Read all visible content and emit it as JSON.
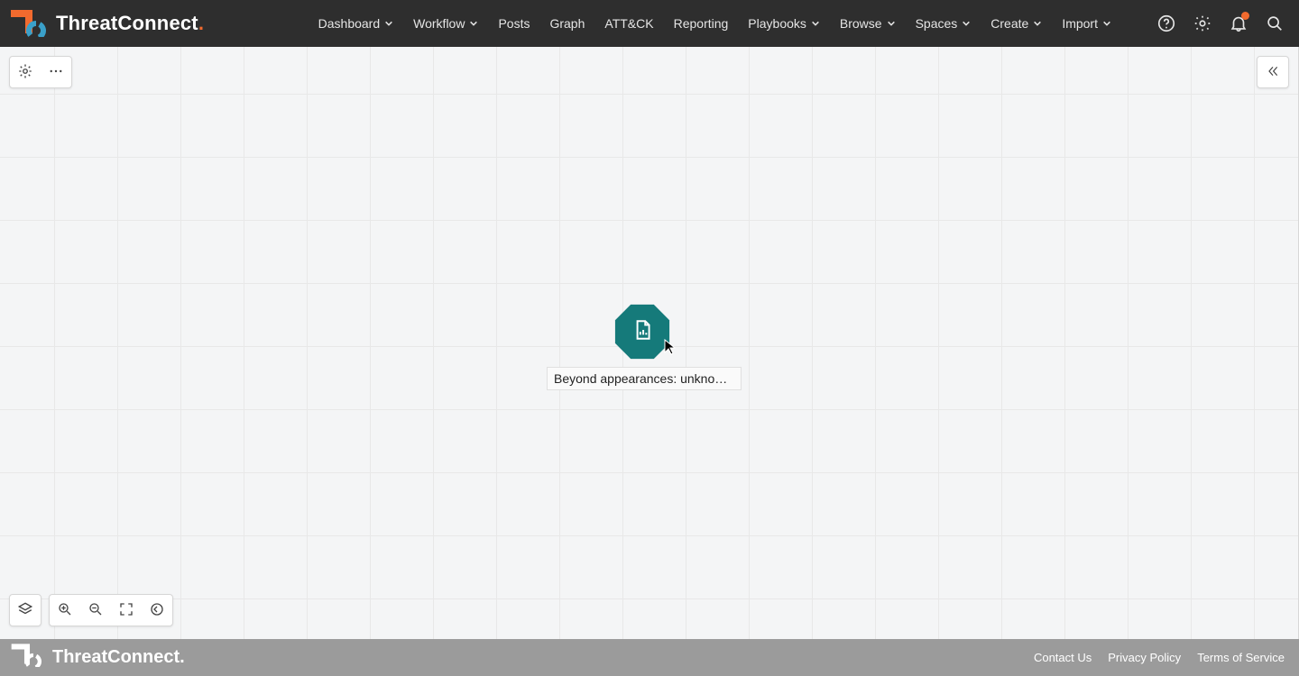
{
  "brand": "ThreatConnect",
  "nav": {
    "items": [
      {
        "label": "Dashboard",
        "dropdown": true
      },
      {
        "label": "Workflow",
        "dropdown": true
      },
      {
        "label": "Posts",
        "dropdown": false
      },
      {
        "label": "Graph",
        "dropdown": false
      },
      {
        "label": "ATT&CK",
        "dropdown": false
      },
      {
        "label": "Reporting",
        "dropdown": false
      },
      {
        "label": "Playbooks",
        "dropdown": true
      },
      {
        "label": "Browse",
        "dropdown": true
      },
      {
        "label": "Spaces",
        "dropdown": true
      },
      {
        "label": "Create",
        "dropdown": true
      },
      {
        "label": "Import",
        "dropdown": true
      }
    ]
  },
  "canvas": {
    "node": {
      "label": "Beyond appearances: unknown a…",
      "type": "report"
    }
  },
  "footer": {
    "brand": "ThreatConnect",
    "links": [
      {
        "label": "Contact Us"
      },
      {
        "label": "Privacy Policy"
      },
      {
        "label": "Terms of Service"
      }
    ]
  },
  "colors": {
    "accent": "#f26a2e",
    "node": "#157a7a",
    "topbar": "#2e2e2e"
  }
}
